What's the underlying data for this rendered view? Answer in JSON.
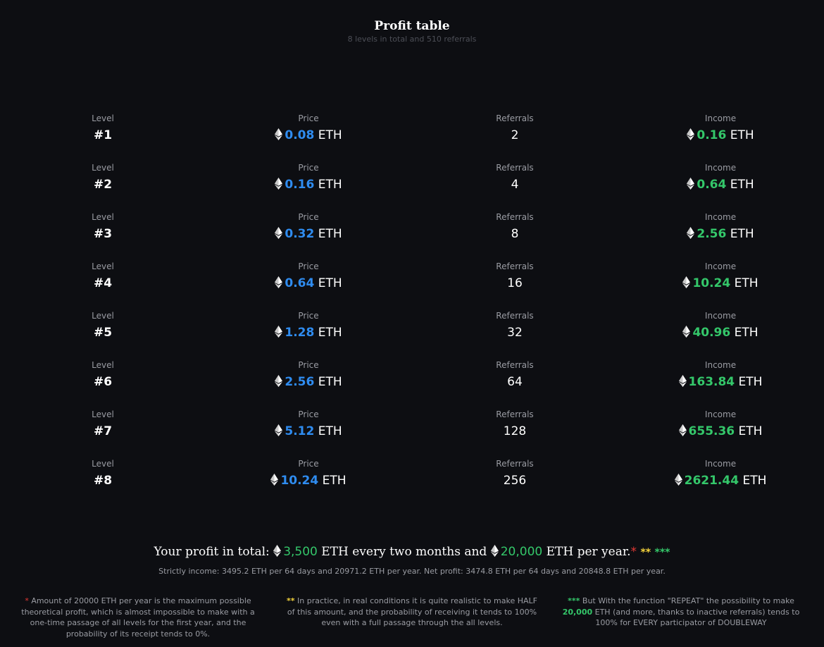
{
  "header": {
    "title": "Profit table",
    "subtitle": "8 levels in total and 510 referrals"
  },
  "columns": {
    "level": "Level",
    "price": "Price",
    "referrals": "Referrals",
    "income": "Income"
  },
  "currency": "ETH",
  "rows": [
    {
      "level": "#1",
      "price": "0.08",
      "referrals": "2",
      "income": "0.16"
    },
    {
      "level": "#2",
      "price": "0.16",
      "referrals": "4",
      "income": "0.64"
    },
    {
      "level": "#3",
      "price": "0.32",
      "referrals": "8",
      "income": "2.56"
    },
    {
      "level": "#4",
      "price": "0.64",
      "referrals": "16",
      "income": "10.24"
    },
    {
      "level": "#5",
      "price": "1.28",
      "referrals": "32",
      "income": "40.96"
    },
    {
      "level": "#6",
      "price": "2.56",
      "referrals": "64",
      "income": "163.84"
    },
    {
      "level": "#7",
      "price": "5.12",
      "referrals": "128",
      "income": "655.36"
    },
    {
      "level": "#8",
      "price": "10.24",
      "referrals": "256",
      "income": "2621.44"
    }
  ],
  "total": {
    "prefix": "Your profit in total:",
    "amount1": "3,500",
    "unit1": "ETH every two months and",
    "amount2": "20,000",
    "unit2": "ETH per year.",
    "star1": "*",
    "star2": "**",
    "star3": "***"
  },
  "strict": "Strictly income: 3495.2 ETH per 64 days and 20971.2 ETH per year. Net profit: 3474.8 ETH per 64 days and 20848.8 ETH per year.",
  "notes": {
    "n1_star": "*",
    "n1_text": "Amount of 20000 ETH per year is the maximum possible theoretical profit, which is almost impossible to make with a one-time passage of all levels for the first year, and the probability of its receipt tends to 0%.",
    "n2_star": "**",
    "n2_text": "In practice, in real conditions it is quite realistic to make HALF of this amount, and the probability of receiving it tends to 100% even with a full passage through the all levels.",
    "n3_star": "***",
    "n3_text_a": "But With the function \"REPEAT\" the possibility to make",
    "n3_amount": "20,000",
    "n3_text_b": "ETH (and more, thanks to inactive referrals) tends to 100% for EVERY participator of DOUBLEWAY"
  },
  "colors": {
    "background": "#0d0e12",
    "price_blue": "#2f8cf0",
    "income_green": "#34c76a",
    "star_red": "#e53935",
    "star_yellow": "#f3d23b",
    "label_gray": "#9a9ca3"
  },
  "icons": {
    "currency": "ethereum-icon"
  }
}
